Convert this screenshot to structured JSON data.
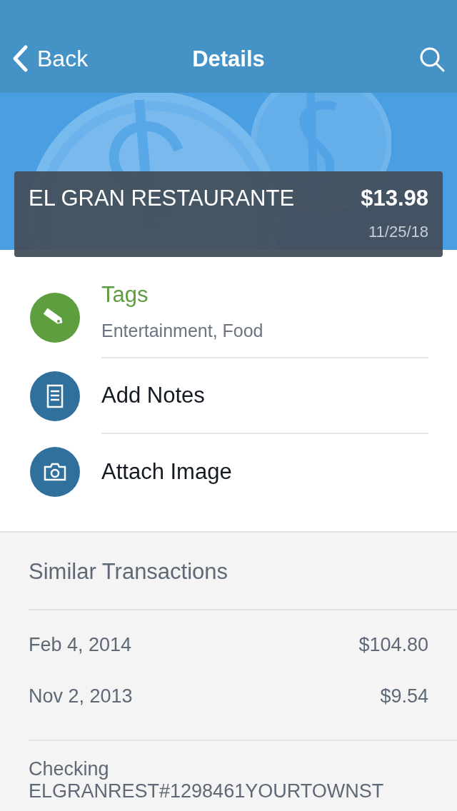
{
  "nav": {
    "back": "Back",
    "title": "Details"
  },
  "transaction": {
    "merchant": "EL GRAN RESTAURANTE",
    "amount": "$13.98",
    "date": "11/25/18"
  },
  "actions": [
    {
      "kind": "tag",
      "label": "Tags",
      "value": "Entertainment, Food",
      "color": "#5e9e3e"
    },
    {
      "kind": "notes",
      "label": "Add Notes",
      "color": "#30709c"
    },
    {
      "kind": "camera",
      "label": "Attach Image",
      "color": "#30709c"
    }
  ],
  "similar": {
    "title": "Similar Transactions",
    "rows": [
      {
        "date": "Feb 4, 2014",
        "amount": "$104.80"
      },
      {
        "date": "Nov 2, 2013",
        "amount": "$9.54"
      }
    ]
  },
  "account": {
    "type": "Checking",
    "description": "ELGRANREST#1298461YOURTOWNST"
  }
}
